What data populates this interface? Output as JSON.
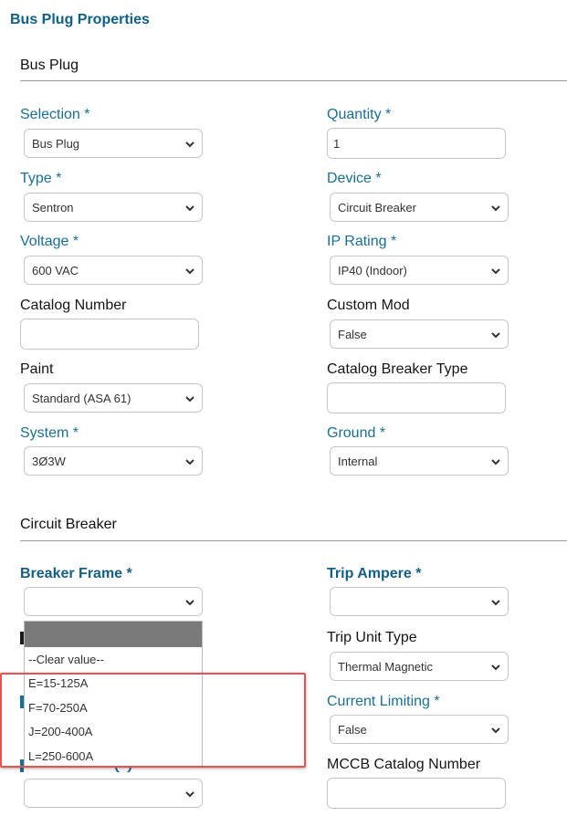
{
  "page_title": "Bus Plug Properties",
  "sections": {
    "bus_plug": "Bus Plug",
    "circuit_breaker": "Circuit Breaker"
  },
  "fields": {
    "selection": {
      "label": "Selection *",
      "value": "Bus Plug"
    },
    "quantity": {
      "label": "Quantity *",
      "value": "1"
    },
    "type": {
      "label": "Type *",
      "value": "Sentron"
    },
    "device": {
      "label": "Device *",
      "value": "Circuit Breaker"
    },
    "voltage": {
      "label": "Voltage *",
      "value": "600 VAC"
    },
    "ip_rating": {
      "label": "IP Rating *",
      "value": "IP40 (Indoor)"
    },
    "catalog_number": {
      "label": "Catalog Number",
      "value": ""
    },
    "custom_mod": {
      "label": "Custom Mod",
      "value": "False"
    },
    "paint": {
      "label": "Paint",
      "value": "Standard (ASA 61)"
    },
    "catalog_breaker_type": {
      "label": "Catalog Breaker Type",
      "value": ""
    },
    "system": {
      "label": "System *",
      "value": "3Ø3W"
    },
    "ground": {
      "label": "Ground *",
      "value": "Internal"
    },
    "breaker_frame": {
      "label": "Breaker Frame *",
      "value": ""
    },
    "trip_ampere": {
      "label": "Trip Ampere *",
      "value": ""
    },
    "trip_unit_type": {
      "label": "Trip Unit Type",
      "value": "Thermal Magnetic"
    },
    "current_limiting": {
      "label": "Current Limiting *",
      "value": "False"
    },
    "mccb_catalog_number": {
      "label": "MCCB Catalog Number",
      "value": ""
    },
    "bottom_left": {
      "value": ""
    }
  },
  "breaker_frame_dropdown": {
    "options": [
      "--Clear value--",
      "E=15-125A",
      "F=70-250A",
      "J=200-400A",
      "L=250-600A"
    ]
  },
  "colors": {
    "label_blue": "#1a6f95",
    "title_blue": "#0f5f86",
    "highlight_red": "#e8534f",
    "dropdown_header": "#7a7a7a"
  }
}
